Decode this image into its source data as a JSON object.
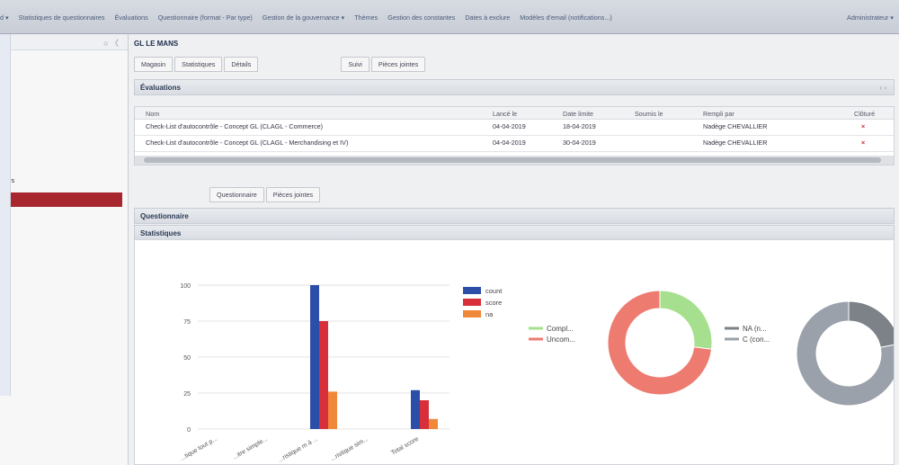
{
  "topbar": {
    "menu": [
      "d ▾",
      "Statistiques de questionnaires",
      "Évaluations",
      "Questionnaire (format - Par type)",
      "Gestion de la gouvernance ▾",
      "Thèmes",
      "Gestion des constantes",
      "Dates à exclure",
      "Modèles d'email (notifications...)"
    ],
    "user": "Administrateur ▾"
  },
  "sidebar": {
    "controls": "○  〈",
    "label": "rs"
  },
  "main": {
    "title": "GL LE MANS",
    "tabs": [
      "Magasin",
      "Statistiques",
      "Détails",
      "Suivi",
      "Pièces jointes"
    ],
    "evaluations": {
      "title": "Évaluations",
      "columns": [
        "Nom",
        "Lancé le",
        "Date limite",
        "Soumis le",
        "Rempli par",
        "Clôturé"
      ],
      "rows": [
        {
          "nom": "Check-List d'autocontrôle - Concept GL (CLAGL - Commerce)",
          "lance": "04-04-2019",
          "limite": "18-04-2019",
          "soumis": "",
          "rempli": "Nadège CHEVALLIER",
          "cloture": "×"
        },
        {
          "nom": "Check-List d'autocontrôle - Concept GL (CLAGL - Merchandising et IV)",
          "lance": "04-04-2019",
          "limite": "30-04-2019",
          "soumis": "",
          "rempli": "Nadège CHEVALLIER",
          "cloture": "×"
        }
      ],
      "pager": "‹ ›"
    },
    "subtabs": [
      "Questionnaire",
      "Pièces jointes"
    ],
    "questionnaire_title": "Questionnaire",
    "stats_title": "Statistiques"
  },
  "chart_data": [
    {
      "type": "bar",
      "categories": [
        "...tique tout p...",
        "...itre simple...",
        "...ristique m à ...",
        "...ristique sim...",
        "Total score"
      ],
      "series": [
        {
          "name": "count",
          "color": "#2b4ea8",
          "values": [
            0,
            0,
            100,
            0,
            27
          ]
        },
        {
          "name": "score",
          "color": "#d8303a",
          "values": [
            0,
            0,
            75,
            0,
            20
          ]
        },
        {
          "name": "na",
          "color": "#f0883a",
          "values": [
            0,
            0,
            26,
            0,
            7
          ]
        }
      ],
      "yticks": [
        0,
        25,
        50,
        75,
        100
      ],
      "ylim": [
        0,
        100
      ],
      "grid": true,
      "legend": "right"
    },
    {
      "type": "pie",
      "labels": [
        "Compl...",
        "Uncom..."
      ],
      "values": [
        27,
        73
      ],
      "colors": [
        "#a6e08e",
        "#ee7b70"
      ],
      "legend": "left"
    },
    {
      "type": "pie",
      "labels": [
        "NA (n...",
        "C (con..."
      ],
      "values": [
        22,
        78
      ],
      "colors": [
        "#7d8288",
        "#9aa1aa"
      ],
      "legend": "left"
    }
  ]
}
